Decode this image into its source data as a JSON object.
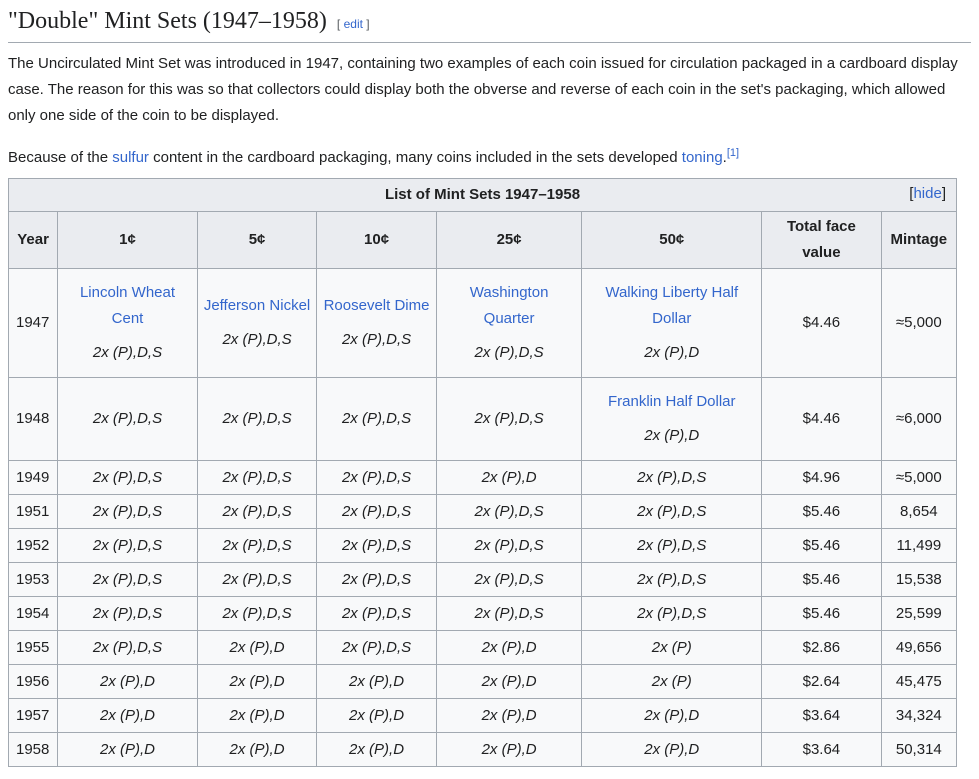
{
  "section": {
    "title": "\"Double\" Mint Sets (1947–1958)",
    "edit_label": "edit"
  },
  "paragraphs": {
    "p1": "The Uncirculated Mint Set was introduced in 1947, containing two examples of each coin issued for circulation packaged in a cardboard display case. The reason for this was so that collectors could display both the obverse and reverse of each coin in the set's packaging, which allowed only one side of the coin to be displayed.",
    "p2_before": "Because of the ",
    "p2_link1": "sulfur",
    "p2_middle": " content in the cardboard packaging, many coins included in the sets developed ",
    "p2_link2": "toning",
    "p2_after": ".",
    "p2_ref": "[1]"
  },
  "table": {
    "caption": "List of Mint Sets 1947–1958",
    "hide_label": "hide",
    "headers": [
      "Year",
      "1¢",
      "5¢",
      "10¢",
      "25¢",
      "50¢",
      "Total face value",
      "Mintage"
    ],
    "row1947": {
      "year": "1947",
      "coins": [
        {
          "name": "Lincoln Wheat Cent",
          "mints": "2x (P),D,S"
        },
        {
          "name": "Jefferson Nickel",
          "mints": "2x (P),D,S"
        },
        {
          "name": "Roosevelt Dime",
          "mints": "2x (P),D,S"
        },
        {
          "name": "Washington Quarter",
          "mints": "2x (P),D,S"
        },
        {
          "name": "Walking Liberty Half Dollar",
          "mints": "2x (P),D"
        }
      ],
      "face": "$4.46",
      "mintage": "≈5,000"
    },
    "row1948": {
      "year": "1948",
      "c1": "2x (P),D,S",
      "c5": "2x (P),D,S",
      "c10": "2x (P),D,S",
      "c25": "2x (P),D,S",
      "c50_name": "Franklin Half Dollar",
      "c50": "2x (P),D",
      "face": "$4.46",
      "mintage": "≈6,000"
    },
    "rows": [
      {
        "year": "1949",
        "c1": "2x (P),D,S",
        "c5": "2x (P),D,S",
        "c10": "2x (P),D,S",
        "c25": "2x (P),D",
        "c50": "2x (P),D,S",
        "face": "$4.96",
        "mintage": "≈5,000"
      },
      {
        "year": "1951",
        "c1": "2x (P),D,S",
        "c5": "2x (P),D,S",
        "c10": "2x (P),D,S",
        "c25": "2x (P),D,S",
        "c50": "2x (P),D,S",
        "face": "$5.46",
        "mintage": "8,654"
      },
      {
        "year": "1952",
        "c1": "2x (P),D,S",
        "c5": "2x (P),D,S",
        "c10": "2x (P),D,S",
        "c25": "2x (P),D,S",
        "c50": "2x (P),D,S",
        "face": "$5.46",
        "mintage": "11,499"
      },
      {
        "year": "1953",
        "c1": "2x (P),D,S",
        "c5": "2x (P),D,S",
        "c10": "2x (P),D,S",
        "c25": "2x (P),D,S",
        "c50": "2x (P),D,S",
        "face": "$5.46",
        "mintage": "15,538"
      },
      {
        "year": "1954",
        "c1": "2x (P),D,S",
        "c5": "2x (P),D,S",
        "c10": "2x (P),D,S",
        "c25": "2x (P),D,S",
        "c50": "2x (P),D,S",
        "face": "$5.46",
        "mintage": "25,599"
      },
      {
        "year": "1955",
        "c1": "2x (P),D,S",
        "c5": "2x (P),D",
        "c10": "2x (P),D,S",
        "c25": "2x (P),D",
        "c50": "2x (P)",
        "face": "$2.86",
        "mintage": "49,656"
      },
      {
        "year": "1956",
        "c1": "2x (P),D",
        "c5": "2x (P),D",
        "c10": "2x (P),D",
        "c25": "2x (P),D",
        "c50": "2x (P)",
        "face": "$2.64",
        "mintage": "45,475"
      },
      {
        "year": "1957",
        "c1": "2x (P),D",
        "c5": "2x (P),D",
        "c10": "2x (P),D",
        "c25": "2x (P),D",
        "c50": "2x (P),D",
        "face": "$3.64",
        "mintage": "34,324"
      },
      {
        "year": "1958",
        "c1": "2x (P),D",
        "c5": "2x (P),D",
        "c10": "2x (P),D",
        "c25": "2x (P),D",
        "c50": "2x (P),D",
        "face": "$3.64",
        "mintage": "50,314"
      }
    ]
  }
}
